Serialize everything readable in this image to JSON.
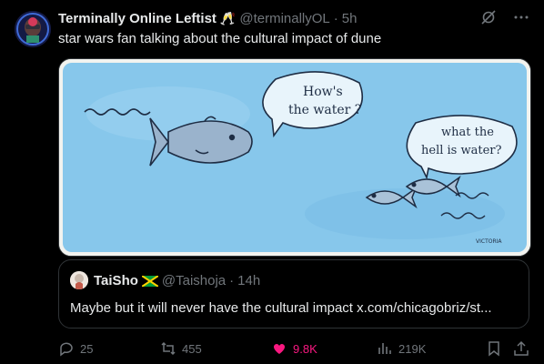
{
  "post": {
    "display_name": "Terminally Online Leftist",
    "name_emoji": "🥂",
    "handle": "@terminallyOL",
    "separator": "·",
    "time": "5h",
    "text": "star wars fan talking about the cultural impact of dune"
  },
  "image": {
    "bubble1": [
      "How's",
      "the water ?"
    ],
    "bubble2": [
      "what the",
      "hell is water?"
    ],
    "signature": "VICTORIA"
  },
  "quote": {
    "display_name": "TaiSho",
    "handle": "@Taishoja",
    "separator": "·",
    "time": "14h",
    "text": "Maybe but it will never have the cultural impact x.com/chicagobriz/st..."
  },
  "actions": {
    "replies": "25",
    "reposts": "455",
    "likes": "9.8K",
    "views": "219K"
  },
  "colors": {
    "background": "#000000",
    "text": "#e7e9ea",
    "muted": "#71767b",
    "like": "#f91880",
    "water": "#7fc1e6"
  },
  "icons": [
    "grok-icon",
    "more-icon",
    "reply-icon",
    "repost-icon",
    "heart-icon",
    "views-icon",
    "bookmark-icon",
    "share-icon",
    "jamaica-flag-icon"
  ]
}
